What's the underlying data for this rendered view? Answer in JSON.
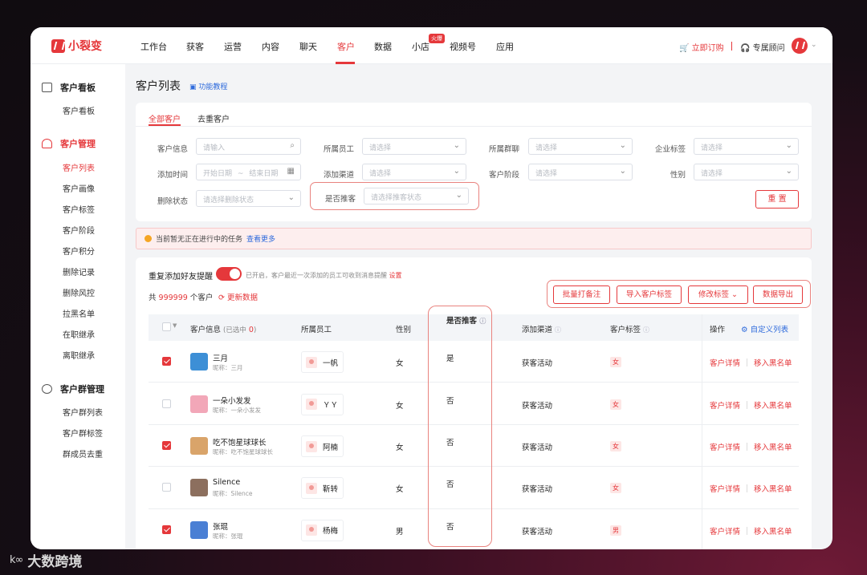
{
  "brand": {
    "name": "小裂变"
  },
  "nav": {
    "items": [
      "工作台",
      "获客",
      "运营",
      "内容",
      "聊天",
      "客户",
      "数据",
      "小店",
      "视频号",
      "应用"
    ],
    "active": "客户",
    "hot_badge": "火爆",
    "order_label": "立即订购",
    "consultant_label": "专属顾问"
  },
  "sidebar": {
    "groups": [
      {
        "title": "客户看板",
        "items": [
          "客户看板"
        ]
      },
      {
        "title": "客户管理",
        "items": [
          "客户列表",
          "客户画像",
          "客户标签",
          "客户阶段",
          "客户积分",
          "删除记录",
          "删除风控",
          "拉黑名单",
          "在职继承",
          "离职继承"
        ]
      },
      {
        "title": "客户群管理",
        "items": [
          "客户群列表",
          "客户群标签",
          "群成员去重"
        ]
      }
    ],
    "active_item": "客户列表"
  },
  "page": {
    "title": "客户列表",
    "tutorial": "功能教程"
  },
  "tabs": [
    "全部客户",
    "去重客户"
  ],
  "filters": {
    "customer_info": {
      "label": "客户信息",
      "placeholder": "请输入"
    },
    "employee": {
      "label": "所属员工",
      "placeholder": "请选择"
    },
    "group": {
      "label": "所属群聊",
      "placeholder": "请选择"
    },
    "corp_tag": {
      "label": "企业标签",
      "placeholder": "请选择"
    },
    "add_time": {
      "label": "添加时间",
      "start": "开始日期",
      "sep": "~",
      "end": "结束日期"
    },
    "channel": {
      "label": "添加渠道",
      "placeholder": "请选择"
    },
    "stage": {
      "label": "客户阶段",
      "placeholder": "请选择"
    },
    "gender": {
      "label": "性别",
      "placeholder": "请选择"
    },
    "deleted": {
      "label": "删除状态",
      "placeholder": "请选择删除状态"
    },
    "recommend": {
      "label": "是否推客",
      "placeholder": "请选择推客状态"
    },
    "reset_label": "重 置"
  },
  "notice": {
    "text": "当前暂无正在进行中的任务",
    "link": "查看更多"
  },
  "duplicate": {
    "label": "重复添加好友提醒",
    "hint": "已开启，客户最近一次添加的员工可收到消息提醒",
    "hint_link": "设置"
  },
  "summary": {
    "prefix": "共",
    "count": "999999",
    "suffix": "个客户",
    "refresh": "更新数据"
  },
  "toolbar": {
    "note": "批量打备注",
    "import_tag": "导入客户标签",
    "edit_tag": "修改标签",
    "edit_caret": "⌄",
    "export": "数据导出"
  },
  "table": {
    "headers": {
      "customer": "客户信息",
      "selected_prefix": "(已选中",
      "selected_count": "0",
      "selected_suffix": ")",
      "employee": "所属员工",
      "gender": "性别",
      "recommend": "是否推客",
      "channel": "添加渠道",
      "tag": "客户标签",
      "ops": "操作",
      "custom": "自定义列表"
    },
    "rows": [
      {
        "checked": true,
        "name": "三月",
        "nick": "昵称：三月",
        "employee": "一帆",
        "gender": "女",
        "recommend": "是",
        "channel": "获客活动",
        "tag": "女",
        "avatar_color": "#3d8fd6"
      },
      {
        "checked": false,
        "name": "一朵小发发",
        "nick": "昵称：一朵小发发",
        "employee": "ＹＹ",
        "gender": "女",
        "recommend": "否",
        "channel": "获客活动",
        "tag": "女",
        "avatar_color": "#f2a7b8"
      },
      {
        "checked": true,
        "name": "吃不饱星球球长",
        "nick": "昵称：吃不饱星球球长",
        "employee": "阿楠",
        "gender": "女",
        "recommend": "否",
        "channel": "获客活动",
        "tag": "女",
        "avatar_color": "#d9a46a"
      },
      {
        "checked": false,
        "name": "Silence",
        "nick": "昵称：Silence",
        "employee": "靳转",
        "gender": "女",
        "recommend": "否",
        "channel": "获客活动",
        "tag": "女",
        "avatar_color": "#8c6f5e"
      },
      {
        "checked": true,
        "name": "张琨",
        "nick": "昵称：张琨",
        "employee": "杨梅",
        "gender": "男",
        "recommend": "否",
        "channel": "获客活动",
        "tag": "男",
        "avatar_color": "#4a7fd4"
      }
    ],
    "op_detail": "客户详情",
    "op_blacklist": "移入黑名单"
  },
  "watermark": "大数跨境"
}
